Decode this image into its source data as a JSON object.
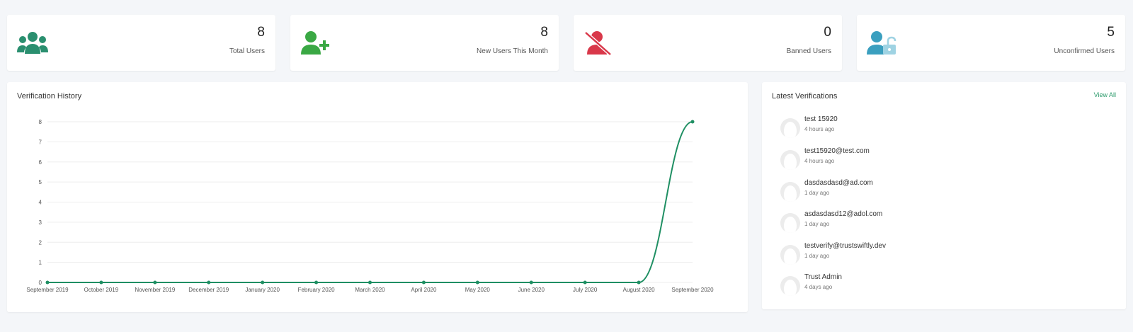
{
  "stats": [
    {
      "value": "8",
      "label": "Total Users",
      "icon": "users-group-icon",
      "color": "#2a8f6f"
    },
    {
      "value": "8",
      "label": "New Users This Month",
      "icon": "user-plus-icon",
      "color": "#3aa844"
    },
    {
      "value": "0",
      "label": "Banned Users",
      "icon": "user-slash-icon",
      "color": "#d9384a"
    },
    {
      "value": "5",
      "label": "Unconfirmed Users",
      "icon": "user-unlock-icon",
      "color": "#3a9fbf"
    }
  ],
  "history": {
    "title": "Verification History"
  },
  "chart_data": {
    "type": "line",
    "title": "Verification History",
    "xlabel": "",
    "ylabel": "",
    "categories": [
      "September 2019",
      "October 2019",
      "November 2019",
      "December 2019",
      "January 2020",
      "February 2020",
      "March 2020",
      "April 2020",
      "May 2020",
      "June 2020",
      "July 2020",
      "August 2020",
      "September 2020"
    ],
    "values": [
      0,
      0,
      0,
      0,
      0,
      0,
      0,
      0,
      0,
      0,
      0,
      0,
      8
    ],
    "ylim": [
      0,
      8
    ],
    "yticks": [
      "0",
      "1",
      "2",
      "3",
      "4",
      "5",
      "6",
      "7",
      "8"
    ],
    "grid": true,
    "color": "#1f8f63"
  },
  "latest": {
    "title": "Latest Verifications",
    "view_all": "View All",
    "items": [
      {
        "name": "test 15920",
        "time": "4 hours ago"
      },
      {
        "name": "test15920@test.com",
        "time": "4 hours ago"
      },
      {
        "name": "dasdasdasd@ad.com",
        "time": "1 day ago"
      },
      {
        "name": "asdasdasd12@adol.com",
        "time": "1 day ago"
      },
      {
        "name": "testverify@trustswiftly.dev",
        "time": "1 day ago"
      },
      {
        "name": "Trust Admin",
        "time": "4 days ago"
      }
    ]
  }
}
